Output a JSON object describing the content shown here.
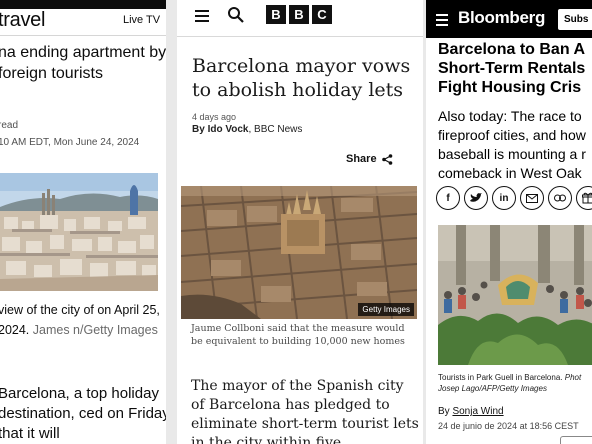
{
  "cnn": {
    "brand": "travel",
    "live_tv": "Live TV",
    "headline": "na ending apartment by foreign tourists",
    "read_time": "read",
    "date": "10 AM EDT, Mon June 24, 2024",
    "caption_text": " view of the city of  on April 25, 2024. ",
    "caption_credit": "James n/Getty Images",
    "body": "Barcelona, a top holiday destination, ced on Friday that it will"
  },
  "bbc": {
    "logo": [
      "B",
      "B",
      "C"
    ],
    "headline": "Barcelona mayor vows to abolish holiday lets",
    "time_ago": "4 days ago",
    "byline_prefix": "By ",
    "byline_author": "Ido Vock",
    "byline_org": ", BBC News",
    "share_label": "Share",
    "image_credit": "Getty Images",
    "caption": "Jaume Collboni said that the measure would be equivalent to building 10,000 new homes",
    "body": "The mayor of the Spanish city of Barcelona has pledged to eliminate short-term tourist lets in the city within five"
  },
  "bloomberg": {
    "brand": "Bloomberg",
    "subscribe": "Subs",
    "headline": "Barcelona to Ban A Short-Term Rentals Fight Housing Cris",
    "dek": "Also today: The race to fireproof cities, and how baseball is mounting a r comeback in West Oak",
    "share_icons": [
      "facebook-icon",
      "twitter-icon",
      "linkedin-icon",
      "email-icon",
      "link-icon",
      "gift-icon"
    ],
    "caption_text": "Tourists in Park Guell in Barcelona. ",
    "caption_credit_1": "Phot",
    "caption_credit_2": "Josep Lago/AFP/Getty Images",
    "byline_prefix": "By ",
    "byline_author": "Sonja Wind",
    "dateline": "24 de junio de 2024 at 18:56 CEST"
  }
}
